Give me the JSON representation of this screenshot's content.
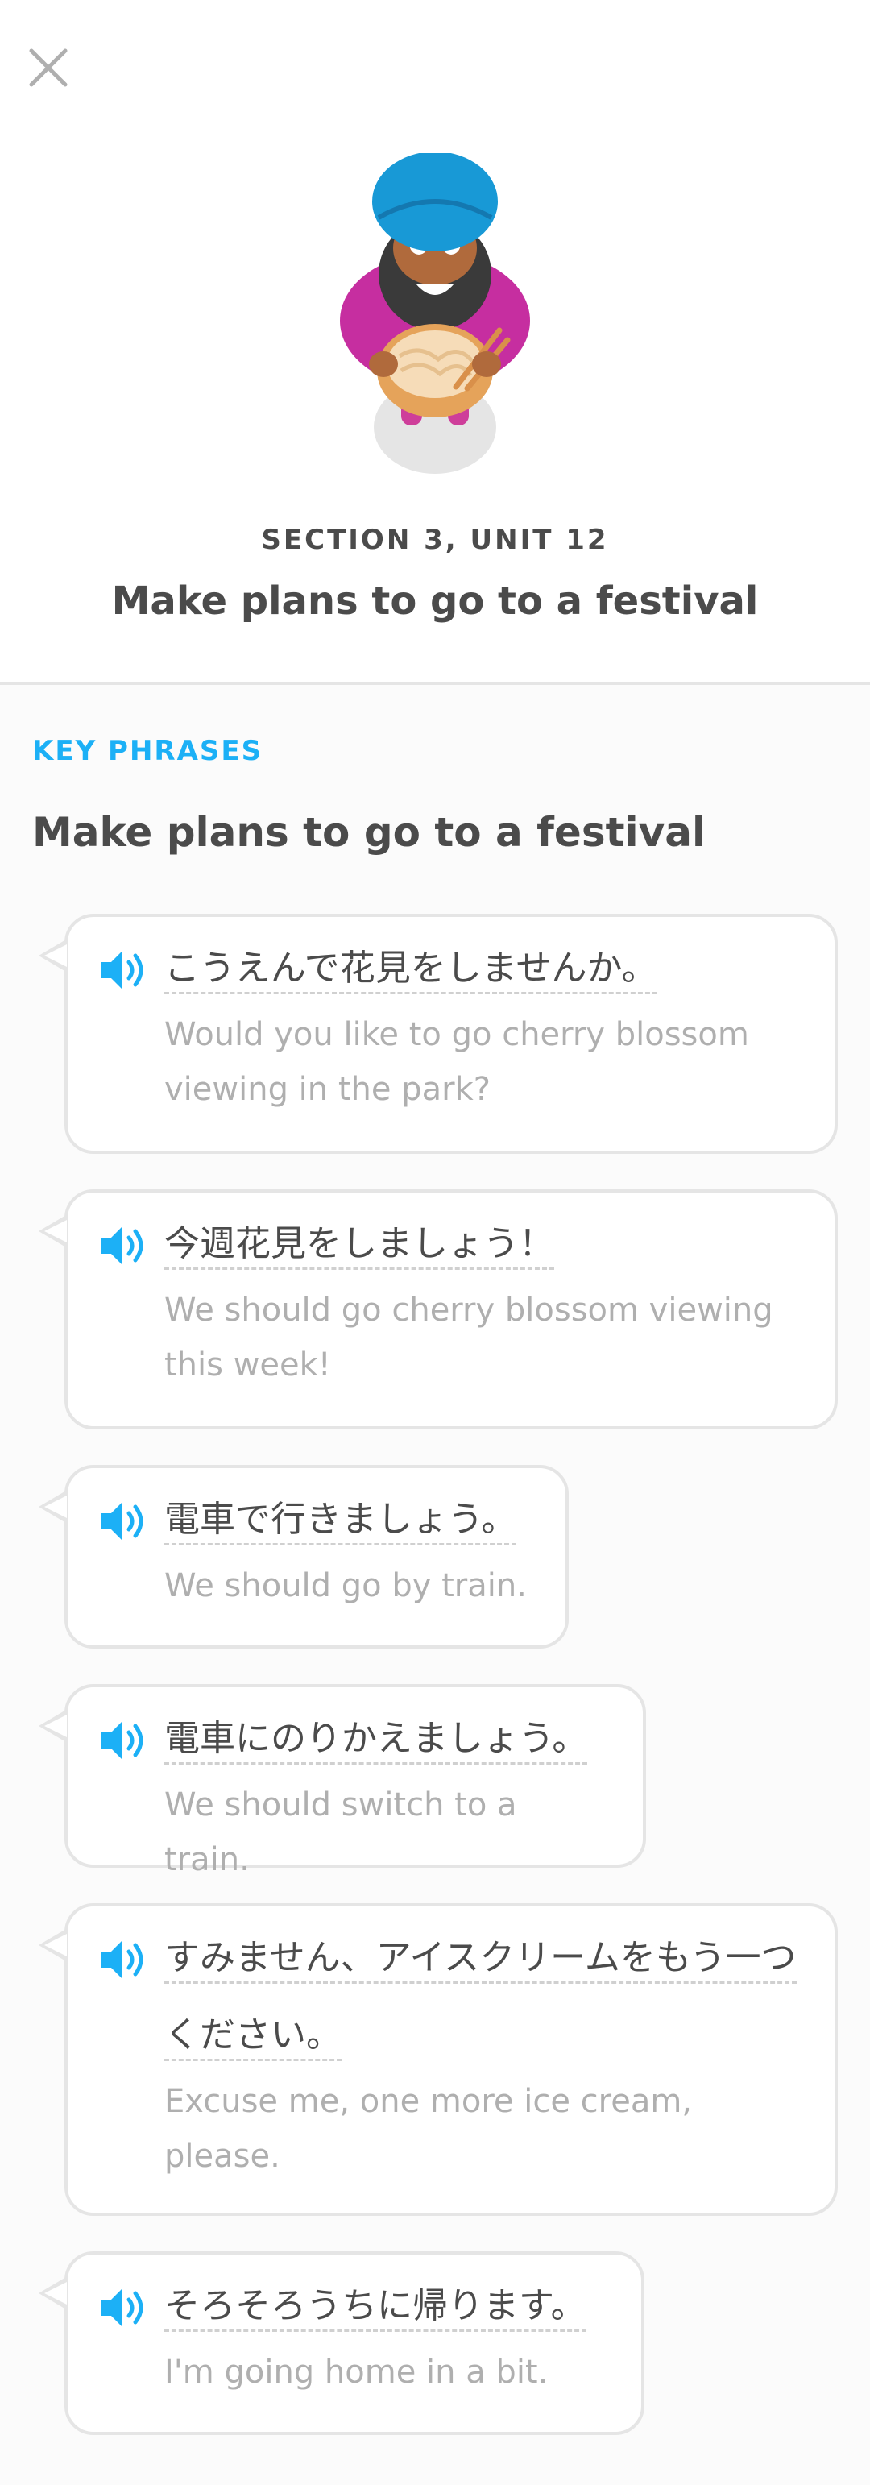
{
  "header": {
    "close_icon": "close-icon",
    "section_label": "SECTION 3, UNIT 12",
    "unit_title": "Make plans to go to a festival"
  },
  "key_phrases": {
    "label": "KEY PHRASES",
    "title": "Make plans to go to a festival",
    "accent_color": "#1cb0f6",
    "phrases": [
      {
        "jp": "こうえんで花見をしませんか。",
        "en": "Would you like to go cherry blossom viewing in the park?"
      },
      {
        "jp": "今週花見をしましょう！",
        "en": "We should go cherry blossom viewing this week!"
      },
      {
        "jp": "電車で行きましょう。",
        "en": "We should go by train."
      },
      {
        "jp": "電車にのりかえましょう。",
        "en": "We should switch to a train."
      },
      {
        "jp": "すみません、アイスクリームをもう一つください。",
        "en": "Excuse me, one more ice cream, please."
      },
      {
        "jp": "そろそろうちに帰ります。",
        "en": "I'm going home in a bit."
      }
    ]
  }
}
